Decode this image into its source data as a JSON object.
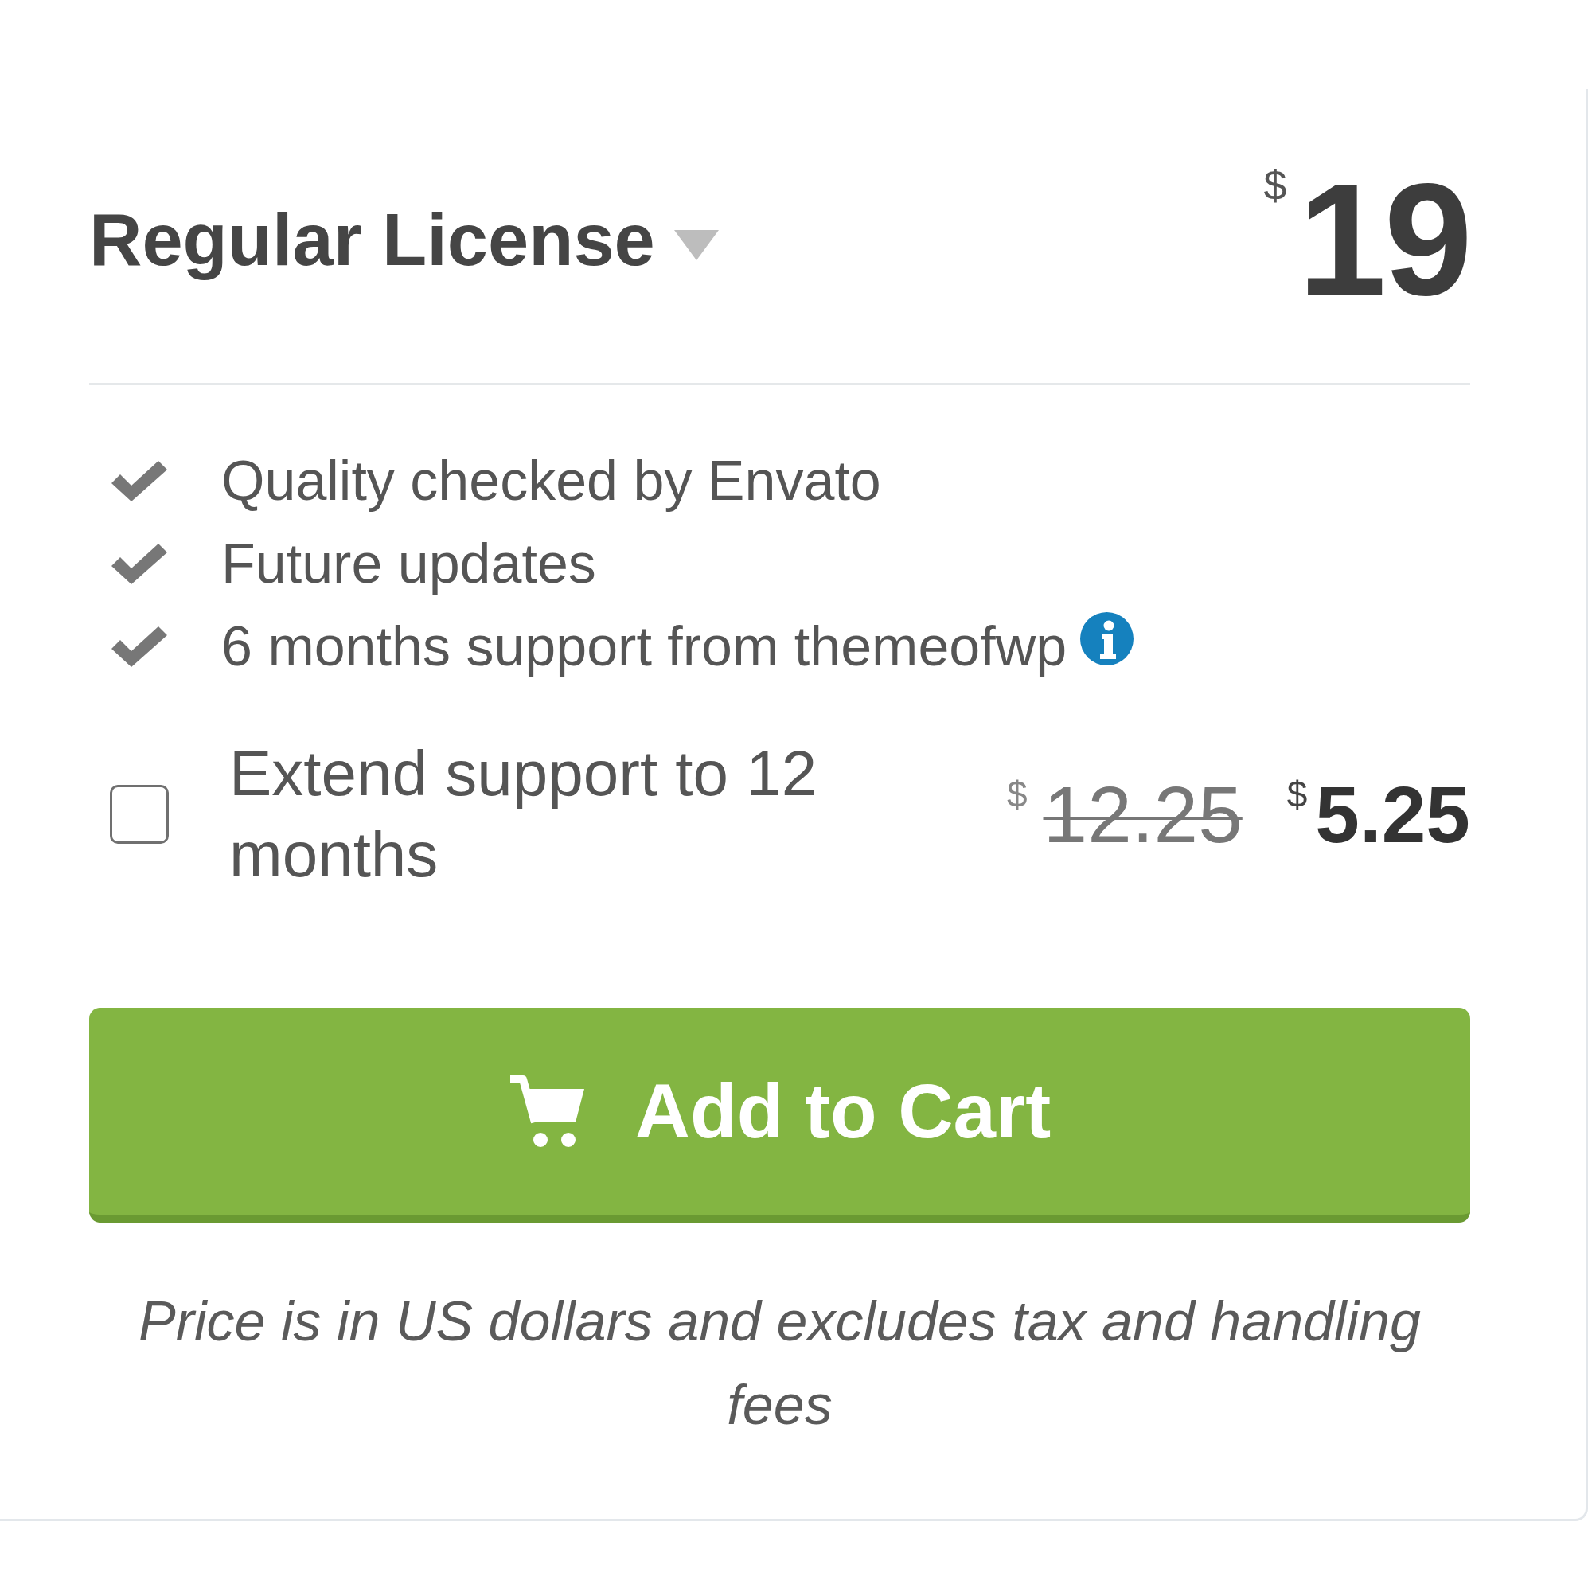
{
  "license": {
    "name": "Regular License",
    "currency": "$",
    "price": "19"
  },
  "features": [
    {
      "text": "Quality checked by Envato",
      "info": false
    },
    {
      "text": "Future updates",
      "info": false
    },
    {
      "text": "6 months support from themeofwp",
      "info": true
    }
  ],
  "extend_support": {
    "checked": false,
    "label": "Extend support to 12 months",
    "old_price": {
      "currency": "$",
      "amount": "12.25"
    },
    "price": {
      "currency": "$",
      "amount": "5.25"
    }
  },
  "add_to_cart": {
    "label": "Add to Cart"
  },
  "note": "Price is in US dollars and excludes tax and handling fees"
}
